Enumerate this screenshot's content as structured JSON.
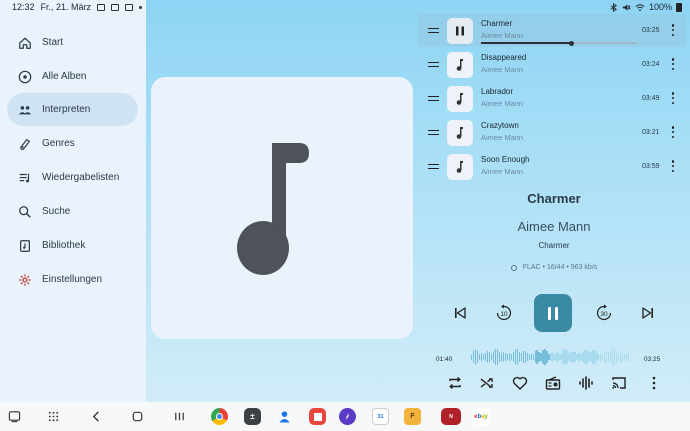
{
  "status": {
    "time": "12:32",
    "date": "Fr., 21. März",
    "battery": "100%"
  },
  "sidebar": {
    "items": [
      {
        "label": "Start",
        "icon": "home-icon"
      },
      {
        "label": "Alle Alben",
        "icon": "disc-icon"
      },
      {
        "label": "Interpreten",
        "icon": "people-icon",
        "active": true
      },
      {
        "label": "Genres",
        "icon": "guitar-icon"
      },
      {
        "label": "Wiedergabelisten",
        "icon": "playlist-icon"
      },
      {
        "label": "Suche",
        "icon": "search-icon"
      },
      {
        "label": "Bibliothek",
        "icon": "library-icon"
      },
      {
        "label": "Einstellungen",
        "icon": "gear-icon"
      }
    ]
  },
  "queue": [
    {
      "title": "Charmer",
      "artist": "Aimee Mann",
      "duration": "03:25",
      "playing": true,
      "progress": 0.58
    },
    {
      "title": "Disappeared",
      "artist": "Aimee Mann",
      "duration": "03:24"
    },
    {
      "title": "Labrador",
      "artist": "Aimee Mann",
      "duration": "03:49"
    },
    {
      "title": "Crazytown",
      "artist": "Aimee Mann",
      "duration": "03:21"
    },
    {
      "title": "Soon Enough",
      "artist": "Aimee Mann",
      "duration": "03:59"
    }
  ],
  "now_playing": {
    "title": "Charmer",
    "artist": "Aimee Mann",
    "album": "Charmer",
    "format": "FLAC • 16/44 • 963 kb/s",
    "elapsed": "01:40",
    "total": "03:25",
    "rewind_seconds": "10",
    "forward_seconds": "30"
  },
  "colors": {
    "accent": "#3b8aa5",
    "sidebar_active": "#cfe3f3",
    "wave": "#76bedb",
    "settings_icon": "#c0392b"
  }
}
